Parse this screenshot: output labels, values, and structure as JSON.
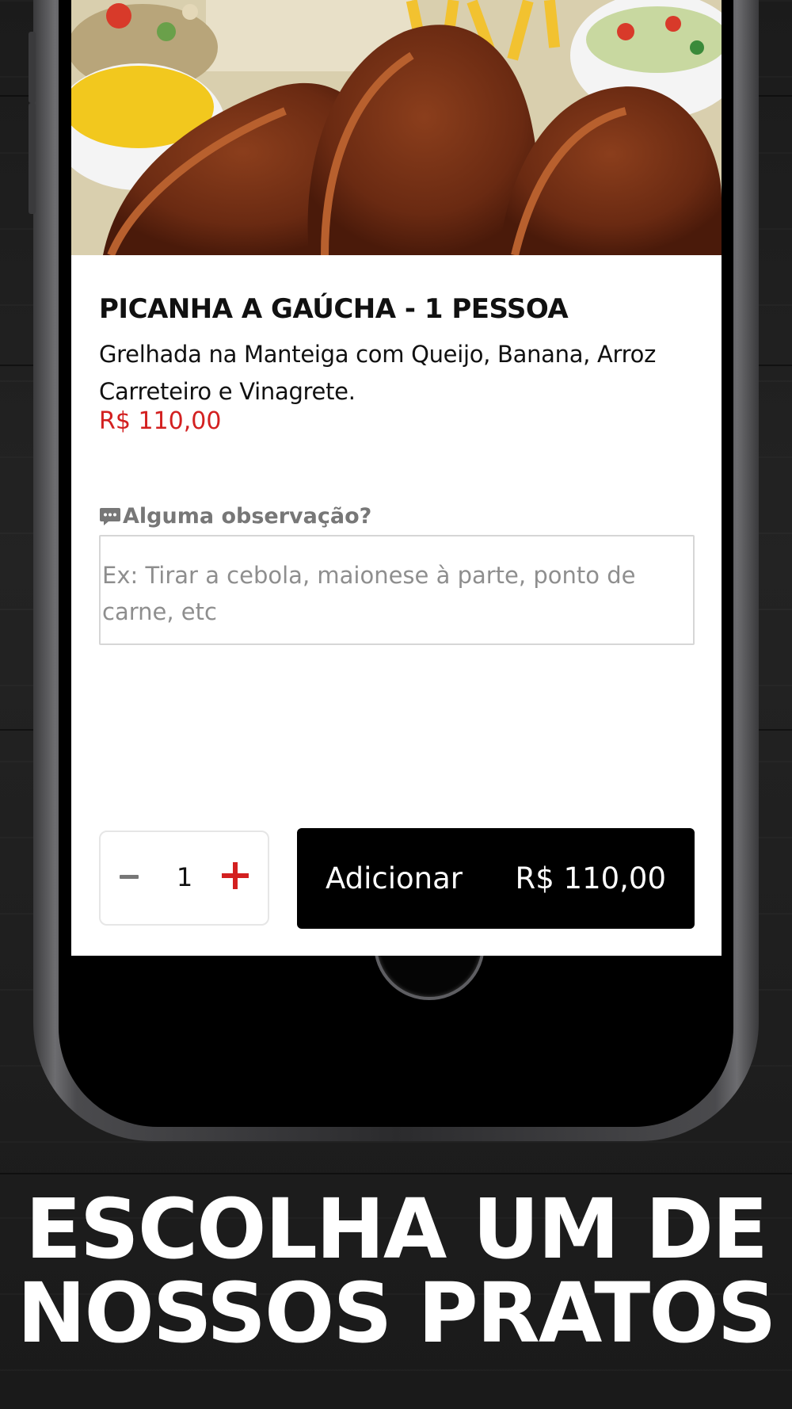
{
  "dish": {
    "name": "PICANHA A GAÚCHA - 1 PESSOA",
    "description": "Grelhada na Manteiga com Queijo, Banana, Arroz Carreteiro e Vinagrete.",
    "price": "R$ 110,00"
  },
  "observation": {
    "label": "Alguma observação?",
    "icon": "comment-dots-icon",
    "placeholder": "Ex: Tirar a cebola, maionese à parte, ponto de carne, etc"
  },
  "quantity": {
    "decrement_icon": "minus-icon",
    "value": "1",
    "increment_icon": "plus-icon"
  },
  "add_button": {
    "label": "Adicionar",
    "price": "R$ 110,00"
  },
  "caption": {
    "line1": "ESCOLHA UM DE",
    "line2": "NOSSOS PRATOS"
  },
  "colors": {
    "accent": "#d32020",
    "button_bg": "#000000",
    "text": "#111111",
    "muted": "#777777"
  }
}
